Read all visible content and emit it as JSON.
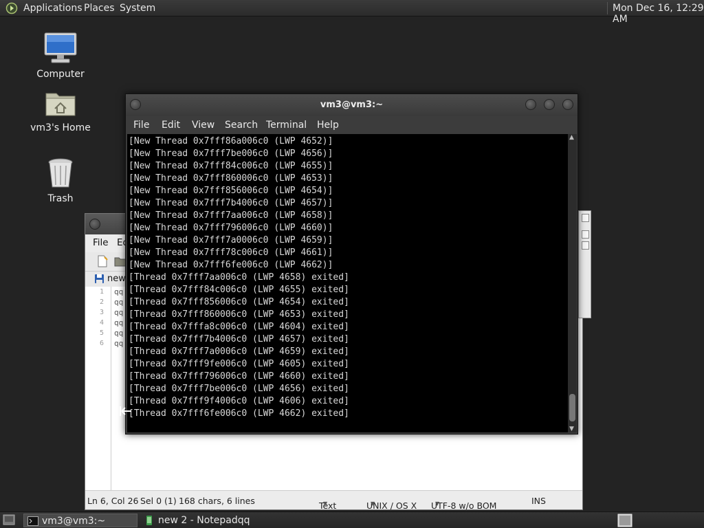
{
  "top_panel": {
    "menu": [
      "Applications",
      "Places",
      "System"
    ],
    "clock": "Mon Dec 16, 12:29 AM"
  },
  "desktop": {
    "icons": [
      {
        "label": "Computer",
        "icon": "computer-icon"
      },
      {
        "label": "vm3's Home",
        "icon": "home-folder-icon"
      },
      {
        "label": "Trash",
        "icon": "trash-icon"
      }
    ]
  },
  "notepadqq": {
    "menu": [
      "File",
      "Ed"
    ],
    "tab_label": "new",
    "line_numbers": [
      "1",
      "2",
      "3",
      "4",
      "5",
      "6"
    ],
    "lines": [
      "qq",
      "qq",
      "qq",
      "qq",
      "qq",
      "qq"
    ],
    "status": {
      "position": "Ln 6, Col 26",
      "selection": "Sel 0 (1)",
      "counts": "168 chars, 6 lines",
      "language": "Text",
      "eol": "UNIX / OS X",
      "encoding": "UTF-8 w/o BOM",
      "mode": "INS"
    }
  },
  "terminal": {
    "title": "vm3@vm3:~",
    "menu": [
      "File",
      "Edit",
      "View",
      "Search",
      "Terminal",
      "Help"
    ],
    "lines": [
      "[New Thread 0x7fff86a006c0 (LWP 4652)]",
      "[New Thread 0x7fff7be006c0 (LWP 4656)]",
      "[New Thread 0x7fff84c006c0 (LWP 4655)]",
      "[New Thread 0x7fff860006c0 (LWP 4653)]",
      "[New Thread 0x7fff856006c0 (LWP 4654)]",
      "[New Thread 0x7fff7b4006c0 (LWP 4657)]",
      "[New Thread 0x7fff7aa006c0 (LWP 4658)]",
      "[New Thread 0x7fff796006c0 (LWP 4660)]",
      "[New Thread 0x7fff7a0006c0 (LWP 4659)]",
      "[New Thread 0x7fff78c006c0 (LWP 4661)]",
      "[New Thread 0x7fff6fe006c0 (LWP 4662)]",
      "[Thread 0x7fff7aa006c0 (LWP 4658) exited]",
      "[Thread 0x7fff84c006c0 (LWP 4655) exited]",
      "[Thread 0x7fff856006c0 (LWP 4654) exited]",
      "[Thread 0x7fff860006c0 (LWP 4653) exited]",
      "[Thread 0x7fffa8c006c0 (LWP 4604) exited]",
      "[Thread 0x7fff7b4006c0 (LWP 4657) exited]",
      "[Thread 0x7fff7a0006c0 (LWP 4659) exited]",
      "[Thread 0x7fff9fe006c0 (LWP 4605) exited]",
      "[Thread 0x7fff796006c0 (LWP 4660) exited]",
      "[Thread 0x7fff7be006c0 (LWP 4656) exited]",
      "[Thread 0x7fff9f4006c0 (LWP 4606) exited]",
      "[Thread 0x7fff6fe006c0 (LWP 4662) exited]"
    ]
  },
  "taskbar": {
    "items": [
      {
        "label": "vm3@vm3:~",
        "active": true
      },
      {
        "label": "new 2 - Notepadqq",
        "active": false
      }
    ]
  }
}
